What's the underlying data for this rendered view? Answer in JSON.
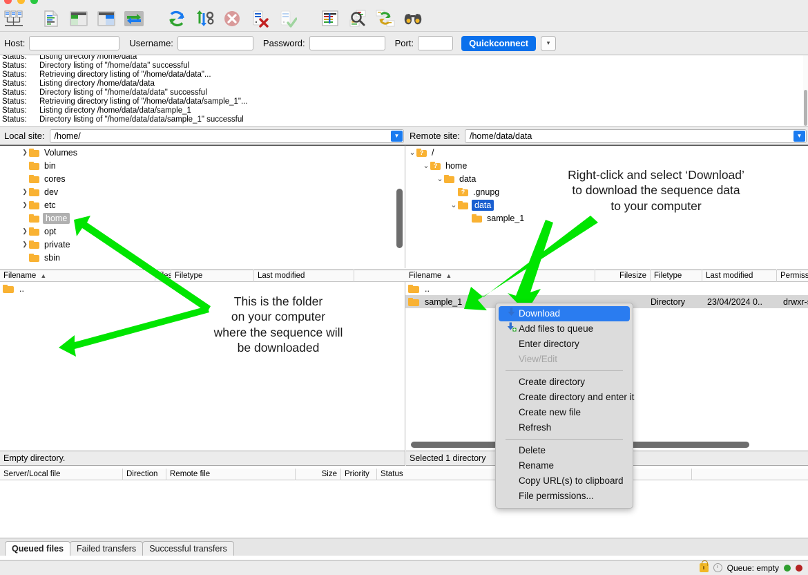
{
  "window": {
    "traffic_lights": [
      "close",
      "minimize",
      "zoom"
    ]
  },
  "toolbar": {
    "buttons": [
      {
        "name": "site-manager-icon",
        "label": "Open the Site Manager"
      },
      {
        "name": "toggle-message-log-icon",
        "label": "Toggle message log"
      },
      {
        "name": "toggle-local-tree-icon",
        "label": "Toggle local directory tree"
      },
      {
        "name": "toggle-remote-tree-icon",
        "label": "Toggle remote directory tree"
      },
      {
        "name": "toggle-transfer-queue-icon",
        "label": "Toggle transfer queue"
      },
      {
        "name": "refresh-icon",
        "label": "Refresh"
      },
      {
        "name": "process-queue-icon",
        "label": "Process queue"
      },
      {
        "name": "cancel-icon",
        "label": "Cancel current operation"
      },
      {
        "name": "disconnect-icon",
        "label": "Disconnect from server"
      },
      {
        "name": "reconnect-icon",
        "label": "Reconnect"
      },
      {
        "name": "filter-icon",
        "label": "Directory listing filters"
      },
      {
        "name": "compare-directories-icon",
        "label": "Compare directory listings"
      },
      {
        "name": "synchronized-browsing-icon",
        "label": "Toggle synchronized browsing"
      },
      {
        "name": "find-files-icon",
        "label": "Search remote files"
      }
    ]
  },
  "quickconnect": {
    "host_label": "Host:",
    "host_value": "",
    "host_placeholder": "",
    "username_label": "Username:",
    "username_value": "",
    "password_label": "Password:",
    "password_value": "",
    "port_label": "Port:",
    "port_value": "",
    "connect_button": "Quickconnect",
    "dropdown_glyph": "▾"
  },
  "status_log": {
    "key": "Status:",
    "lines": [
      "Listing directory /home/data",
      "Directory listing of \"/home/data\" successful",
      "Retrieving directory listing of \"/home/data/data\"...",
      "Listing directory /home/data/data",
      "Directory listing of \"/home/data/data\" successful",
      "Retrieving directory listing of \"/home/data/data/sample_1\"...",
      "Listing directory /home/data/data/sample_1",
      "Directory listing of \"/home/data/data/sample_1\" successful"
    ]
  },
  "local_pane": {
    "site_label": "Local site:",
    "site_value": "/home/",
    "tree": [
      {
        "label": "Volumes",
        "twisty": "›",
        "indent": 1,
        "selected": false
      },
      {
        "label": "bin",
        "twisty": "",
        "indent": 1,
        "selected": false
      },
      {
        "label": "cores",
        "twisty": "",
        "indent": 1,
        "selected": false
      },
      {
        "label": "dev",
        "twisty": "›",
        "indent": 1,
        "selected": false
      },
      {
        "label": "etc",
        "twisty": "›",
        "indent": 1,
        "selected": false
      },
      {
        "label": "home",
        "twisty": "",
        "indent": 1,
        "selected": true
      },
      {
        "label": "opt",
        "twisty": "›",
        "indent": 1,
        "selected": false
      },
      {
        "label": "private",
        "twisty": "›",
        "indent": 1,
        "selected": false
      },
      {
        "label": "sbin",
        "twisty": "",
        "indent": 1,
        "selected": false
      }
    ],
    "columns": [
      "Filename",
      "Filesize",
      "Filetype",
      "Last modified",
      ""
    ],
    "sort_column": "Filename",
    "sort_direction": "asc",
    "rows": [
      {
        "filename": "..",
        "filesize": "",
        "filetype": "",
        "modified": ""
      }
    ],
    "status": "Empty directory."
  },
  "remote_pane": {
    "site_label": "Remote site:",
    "site_value": "/home/data/data",
    "tree": [
      {
        "label": "/",
        "twisty": "⌄",
        "indent": 0,
        "icon": "question-folder",
        "selected": false
      },
      {
        "label": "home",
        "twisty": "⌄",
        "indent": 1,
        "icon": "question-folder",
        "selected": false
      },
      {
        "label": "data",
        "twisty": "⌄",
        "indent": 2,
        "icon": "folder",
        "selected": false
      },
      {
        "label": ".gnupg",
        "twisty": "",
        "indent": 3,
        "icon": "question-folder",
        "selected": false
      },
      {
        "label": "data",
        "twisty": "⌄",
        "indent": 3,
        "icon": "folder",
        "selected": true
      },
      {
        "label": "sample_1",
        "twisty": "",
        "indent": 4,
        "icon": "folder",
        "selected": false
      }
    ],
    "columns": [
      "Filename",
      "Filesize",
      "Filetype",
      "Last modified",
      "Permissions"
    ],
    "sort_column": "Filename",
    "sort_direction": "asc",
    "rows": [
      {
        "filename": "..",
        "filesize": "",
        "filetype": "",
        "modified": "",
        "permissions": "",
        "selected": false
      },
      {
        "filename": "sample_1",
        "filesize": "",
        "filetype": "Directory",
        "modified": "23/04/2024 0..",
        "permissions": "drwxr-sr",
        "selected": true
      }
    ],
    "status": "Selected 1 directory"
  },
  "context_menu": {
    "items": [
      {
        "label": "Download",
        "icon": "download-arrow-icon",
        "state": "highlighted"
      },
      {
        "label": "Add files to queue",
        "icon": "add-to-queue-icon",
        "state": "normal"
      },
      {
        "label": "Enter directory",
        "icon": "",
        "state": "normal"
      },
      {
        "label": "View/Edit",
        "icon": "",
        "state": "disabled"
      },
      {
        "separator": true
      },
      {
        "label": "Create directory",
        "icon": "",
        "state": "normal"
      },
      {
        "label": "Create directory and enter it",
        "icon": "",
        "state": "normal"
      },
      {
        "label": "Create new file",
        "icon": "",
        "state": "normal"
      },
      {
        "label": "Refresh",
        "icon": "",
        "state": "normal"
      },
      {
        "separator": true
      },
      {
        "label": "Delete",
        "icon": "",
        "state": "normal"
      },
      {
        "label": "Rename",
        "icon": "",
        "state": "normal"
      },
      {
        "label": "Copy URL(s) to clipboard",
        "icon": "",
        "state": "normal"
      },
      {
        "label": "File permissions...",
        "icon": "",
        "state": "normal"
      }
    ]
  },
  "queue": {
    "columns": [
      "Server/Local file",
      "Direction",
      "Remote file",
      "Size",
      "Priority",
      "Status",
      ""
    ],
    "rows": [],
    "tabs": [
      {
        "label": "Queued files",
        "active": true
      },
      {
        "label": "Failed transfers",
        "active": false
      },
      {
        "label": "Successful transfers",
        "active": false
      }
    ]
  },
  "bottom_bar": {
    "queue_status": "Queue: empty",
    "icons": [
      "lock-icon",
      "clock-icon"
    ],
    "leds": [
      "green",
      "red"
    ]
  },
  "annotations": [
    {
      "name": "remote-download-note",
      "text": "Right-click and select ‘Download’\nto download the sequence data\nto your computer"
    },
    {
      "name": "local-folder-note",
      "text": "This is the folder\non your computer\nwhere the sequence will\nbe downloaded"
    }
  ],
  "colors": {
    "arrow_green": "#00e500",
    "accent_blue": "#0a70ec",
    "selection_blue": "#1a5fd0",
    "folder_orange": "#f9b233",
    "menu_highlight": "#2a7cf0"
  }
}
